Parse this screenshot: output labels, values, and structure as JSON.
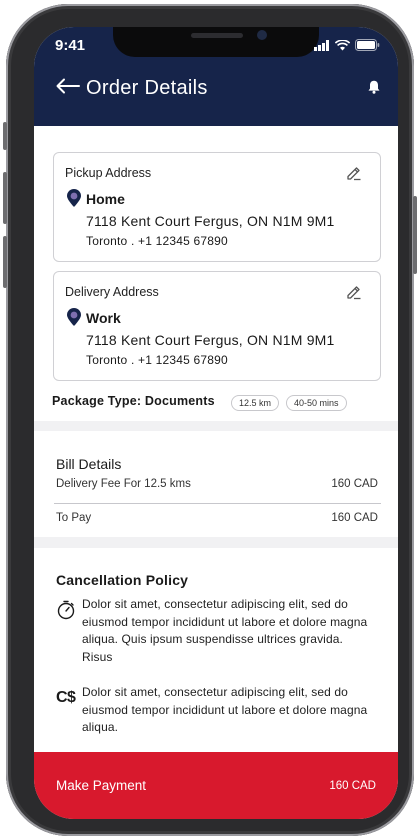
{
  "status_bar": {
    "time": "9:41"
  },
  "header": {
    "title": "Order Details"
  },
  "pickup": {
    "label": "Pickup Address",
    "type": "Home",
    "line1": "7118 Kent Court Fergus, ON N1M 9M1",
    "line2": "Toronto . +1 12345 67890"
  },
  "delivery": {
    "label": "Delivery Address",
    "type": "Work",
    "line1": "7118 Kent Court Fergus, ON N1M 9M1",
    "line2": "Toronto . +1 12345 67890"
  },
  "package": {
    "label": "Package Type: Documents",
    "distance": "12.5 km",
    "eta": "40-50 mins"
  },
  "bill": {
    "title": "Bill Details",
    "fee_label": "Delivery Fee For 12.5 kms",
    "fee_value": "160 CAD",
    "total_label": "To Pay",
    "total_value": "160 CAD"
  },
  "policy": {
    "title": "Cancellation Policy",
    "items": [
      {
        "icon": "timer-icon",
        "text": "Dolor sit amet, consectetur adipiscing elit, sed do eiusmod tempor incididunt ut labore et dolore magna aliqua. Quis ipsum suspendisse ultrices gravida. Risus"
      },
      {
        "icon": "canadian-dollar-icon",
        "glyph": "C$",
        "text": "Dolor sit amet, consectetur adipiscing elit, sed do eiusmod tempor incididunt ut labore et dolore magna aliqua."
      }
    ]
  },
  "footer": {
    "action": "Make Payment",
    "amount": "160 CAD"
  },
  "colors": {
    "header": "#16244a",
    "accent": "#d8192d",
    "pin": "#7e6fb0"
  }
}
